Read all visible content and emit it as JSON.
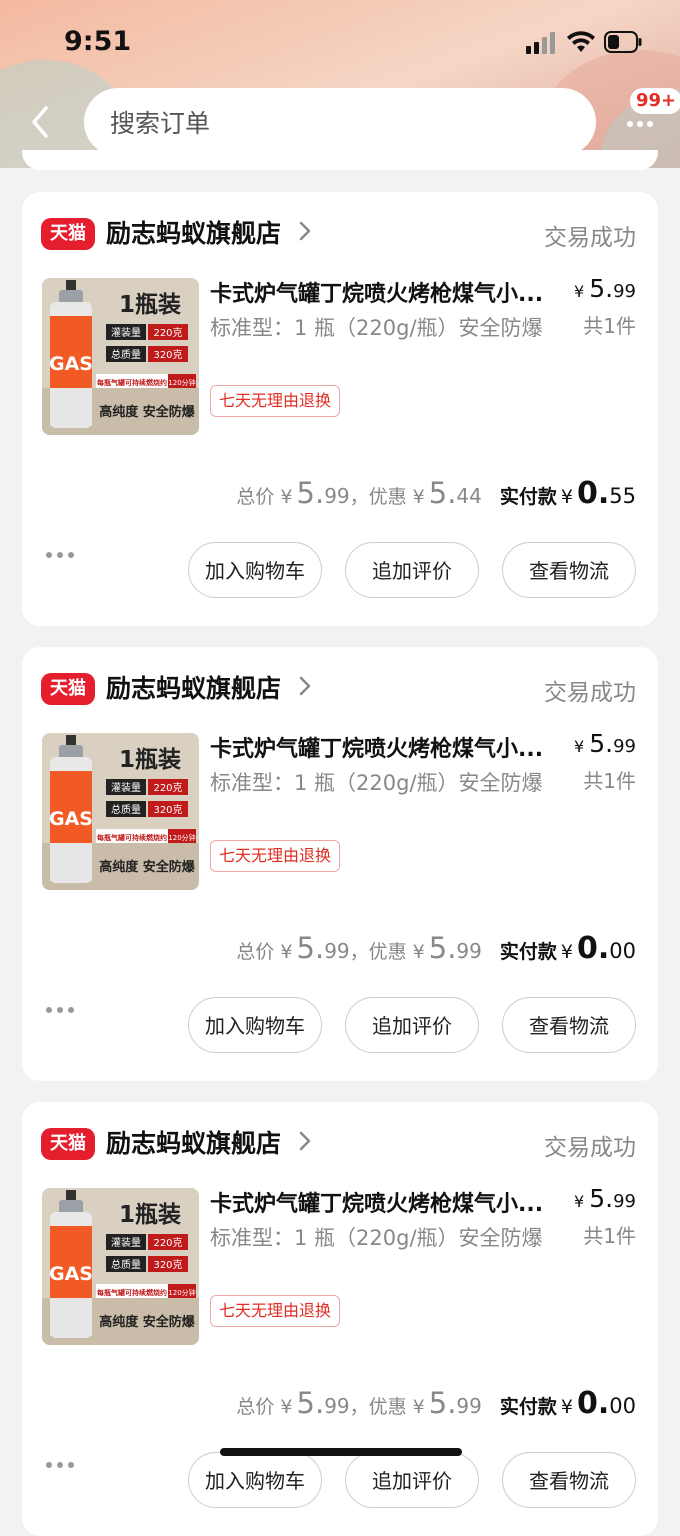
{
  "status_bar": {
    "time": "9:51"
  },
  "header": {
    "search_placeholder": "搜索订单",
    "message_badge": "99+"
  },
  "orders": [
    {
      "platform_tag": "天猫",
      "shop_name": "励志蚂蚁旗舰店",
      "status": "交易成功",
      "product": {
        "title": "卡式炉气罐丁烷喷火烤枪煤气小...",
        "spec": "标准型：1 瓶（220g/瓶）安全防爆",
        "service_tag": "七天无理由退换",
        "price_symbol": "¥",
        "price_int": "5.",
        "price_dec": "99",
        "quantity": "共1件",
        "image": {
          "headline": "1瓶装",
          "row1_label": "灌装量",
          "row1_value": "220克",
          "row2_label": "总质量",
          "row2_value": "320克",
          "burn_note": "每瓶气罐可持续燃烧约",
          "burn_time": "120分钟",
          "can_text": "GAS",
          "footer": "高纯度 安全防爆"
        }
      },
      "totals": {
        "total_label": "总价",
        "currency": "¥",
        "total_int": "5.",
        "total_dec": "99",
        "discount_label": "，优惠",
        "discount_int": "5.",
        "discount_dec": "44",
        "paid_label": "实付款",
        "paid_int": "0.",
        "paid_dec": "55"
      },
      "buttons": [
        "加入购物车",
        "追加评价",
        "查看物流"
      ]
    },
    {
      "platform_tag": "天猫",
      "shop_name": "励志蚂蚁旗舰店",
      "status": "交易成功",
      "product": {
        "title": "卡式炉气罐丁烷喷火烤枪煤气小...",
        "spec": "标准型：1 瓶（220g/瓶）安全防爆",
        "service_tag": "七天无理由退换",
        "price_symbol": "¥",
        "price_int": "5.",
        "price_dec": "99",
        "quantity": "共1件",
        "image": {
          "headline": "1瓶装",
          "row1_label": "灌装量",
          "row1_value": "220克",
          "row2_label": "总质量",
          "row2_value": "320克",
          "burn_note": "每瓶气罐可持续燃烧约",
          "burn_time": "120分钟",
          "can_text": "GAS",
          "footer": "高纯度 安全防爆"
        }
      },
      "totals": {
        "total_label": "总价",
        "currency": "¥",
        "total_int": "5.",
        "total_dec": "99",
        "discount_label": "，优惠",
        "discount_int": "5.",
        "discount_dec": "99",
        "paid_label": "实付款",
        "paid_int": "0.",
        "paid_dec": "00"
      },
      "buttons": [
        "加入购物车",
        "追加评价",
        "查看物流"
      ]
    },
    {
      "platform_tag": "天猫",
      "shop_name": "励志蚂蚁旗舰店",
      "status": "交易成功",
      "product": {
        "title": "卡式炉气罐丁烷喷火烤枪煤气小...",
        "spec": "标准型：1 瓶（220g/瓶）安全防爆",
        "service_tag": "七天无理由退换",
        "price_symbol": "¥",
        "price_int": "5.",
        "price_dec": "99",
        "quantity": "共1件",
        "image": {
          "headline": "1瓶装",
          "row1_label": "灌装量",
          "row1_value": "220克",
          "row2_label": "总质量",
          "row2_value": "320克",
          "burn_note": "每瓶气罐可持续燃烧约",
          "burn_time": "120分钟",
          "can_text": "GAS",
          "footer": "高纯度 安全防爆"
        }
      },
      "totals": {
        "total_label": "总价",
        "currency": "¥",
        "total_int": "5.",
        "total_dec": "99",
        "discount_label": "，优惠",
        "discount_int": "5.",
        "discount_dec": "99",
        "paid_label": "实付款",
        "paid_int": "0.",
        "paid_dec": "00"
      },
      "buttons": [
        "加入购物车",
        "追加评价",
        "查看物流"
      ]
    }
  ],
  "colors": {
    "accent": "#e41e2c",
    "background": "#f2f2f2",
    "muted_text": "#888888"
  },
  "icons": [
    "back-icon",
    "more-icon",
    "chevron-right-icon",
    "signal-icon",
    "wifi-icon",
    "battery-icon"
  ]
}
